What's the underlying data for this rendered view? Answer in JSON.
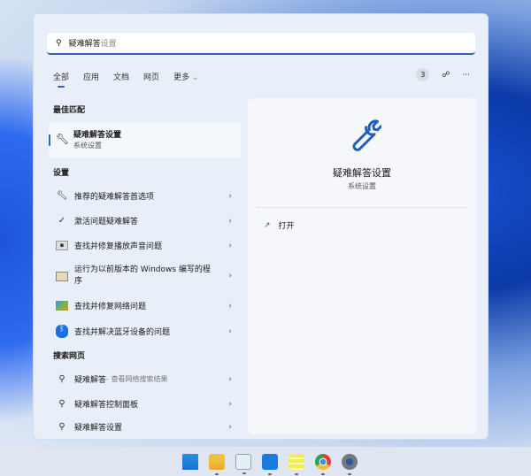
{
  "search": {
    "typed": "疑难解答",
    "suggestion": "设置"
  },
  "tabs": [
    {
      "label": "全部",
      "active": true
    },
    {
      "label": "应用"
    },
    {
      "label": "文档"
    },
    {
      "label": "网页"
    },
    {
      "label": "更多"
    }
  ],
  "toolbar": {
    "badge": "3",
    "more": "···"
  },
  "best_match": {
    "heading": "最佳匹配",
    "title": "疑难解答设置",
    "subtitle": "系统设置"
  },
  "settings": {
    "heading": "设置",
    "items": [
      {
        "label": "推荐的疑难解答首选项",
        "icon": "wrench-icon"
      },
      {
        "label": "激活问题疑难解答",
        "icon": "check-circle-icon"
      },
      {
        "label": "查找并修复播放声音问题",
        "icon": "audio-troubleshoot-icon"
      },
      {
        "label": "运行为以前版本的 Windows 编写的程序",
        "icon": "compatibility-icon"
      },
      {
        "label": "查找并修复网络问题",
        "icon": "network-icon"
      },
      {
        "label": "查找并解决蓝牙设备的问题",
        "icon": "bluetooth-icon"
      }
    ]
  },
  "web": {
    "heading": "搜索网页",
    "items": [
      {
        "label": "疑难解答",
        "sub": " - 查看网络搜索结果"
      },
      {
        "label": "疑难解答控制面板",
        "sub": ""
      },
      {
        "label": "疑难解答设置",
        "sub": ""
      }
    ]
  },
  "preview": {
    "title": "疑难解答设置",
    "subtitle": "系统设置",
    "action": "打开"
  },
  "accent": "#2b63c4",
  "taskbar": [
    "windows-start-icon",
    "file-explorer-icon",
    "photos-icon",
    "app-icon",
    "notes-icon",
    "chrome-icon",
    "settings-icon"
  ]
}
